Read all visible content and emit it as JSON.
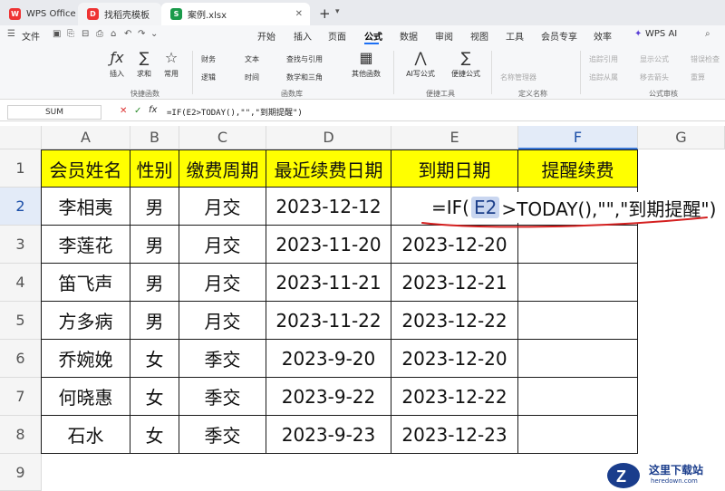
{
  "tabs": {
    "wps": "WPS Office",
    "template": "找稻壳模板",
    "file": "案例.xlsx"
  },
  "menubar": {
    "file": "文件",
    "items": [
      "开始",
      "插入",
      "页面",
      "公式",
      "数据",
      "审阅",
      "视图",
      "工具",
      "会员专享",
      "效率"
    ],
    "ai": "WPS AI"
  },
  "ribbon": {
    "insert_fn": "插入",
    "sum": "求和",
    "common": "常用",
    "group_fn": "快捷函数",
    "finance": "财务",
    "text": "文本",
    "lookup": "查找与引用",
    "logic": "逻辑",
    "time": "时间",
    "math": "数学和三角",
    "other_fn": "其他函数",
    "group_lib": "函数库",
    "ai_write": "AI写公式",
    "quick_formula": "便捷公式",
    "group_tools": "便捷工具",
    "name_mgr": "名称管理器",
    "group_name": "定义名称",
    "trace_prec": "追踪引用",
    "trace_dep": "追踪从属",
    "show_formula": "显示公式",
    "remove_arrows": "移去箭头",
    "error_check": "错误检查",
    "group_audit": "公式审核",
    "recalc": "重算"
  },
  "formula_bar": {
    "name_box": "SUM",
    "content": "=IF(E2>TODAY(),\"\",\"到期提醒\")"
  },
  "columns": [
    "A",
    "B",
    "C",
    "D",
    "E",
    "F",
    "G"
  ],
  "rows": [
    "1",
    "2",
    "3",
    "4",
    "5",
    "6",
    "7",
    "8",
    "9"
  ],
  "sheet": {
    "headers": [
      "会员姓名",
      "性别",
      "缴费周期",
      "最近续费日期",
      "到期日期",
      "提醒续费"
    ],
    "data": [
      [
        "李相夷",
        "男",
        "月交",
        "2023-12-12",
        "",
        ""
      ],
      [
        "李莲花",
        "男",
        "月交",
        "2023-11-20",
        "2023-12-20",
        ""
      ],
      [
        "笛飞声",
        "男",
        "月交",
        "2023-11-21",
        "2023-12-21",
        ""
      ],
      [
        "方多病",
        "男",
        "月交",
        "2023-11-22",
        "2023-12-22",
        ""
      ],
      [
        "乔婉娩",
        "女",
        "季交",
        "2023-9-20",
        "2023-12-20",
        ""
      ],
      [
        "何晓惠",
        "女",
        "季交",
        "2023-9-22",
        "2023-12-22",
        ""
      ],
      [
        "石水",
        "女",
        "季交",
        "2023-9-23",
        "2023-12-23",
        ""
      ]
    ]
  },
  "formula_overlay": {
    "pre": "=IF(",
    "ref": "E2",
    "post": ">TODAY(),\"\",\"到期提醒\")"
  },
  "watermark": {
    "text": "这里下载站",
    "sub": "heredown.com"
  },
  "colors": {
    "header_fill": "#ffff00",
    "accent": "#1c6ff4",
    "underline": "#d42020"
  }
}
